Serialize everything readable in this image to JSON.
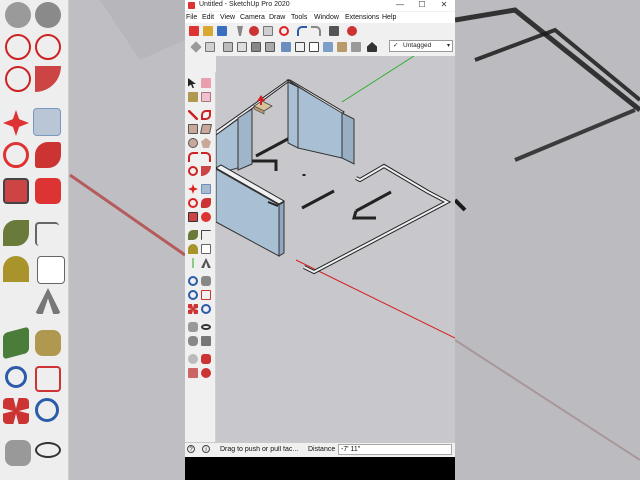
{
  "window": {
    "title": "Untitled - SketchUp Pro 2020",
    "minimize": "—",
    "maximize": "☐",
    "close": "✕"
  },
  "menu": [
    "File",
    "Edit",
    "View",
    "Camera",
    "Draw",
    "Tools",
    "Window",
    "Extensions",
    "Help"
  ],
  "tag_selector": {
    "check": "✓",
    "value": "Untagged",
    "arrow": "▾"
  },
  "status": {
    "message": "Drag to push or pull fac...",
    "distance_label": "Distance",
    "distance_value": "-7' 11\""
  },
  "colors": {
    "viewport_bg": "#c8c7cc",
    "wall_face": "#a9bfd3",
    "wall_top": "#eef0f2",
    "red_axis": "#d42020",
    "green_axis": "#2fae2f",
    "pushpull_arrow": "#d42020"
  },
  "icons": {
    "toolbar_row1": [
      "new-icon",
      "open-icon",
      "save-icon",
      "cut-icon",
      "copy-icon",
      "paste-icon",
      "erase-icon",
      "undo-icon",
      "redo-icon",
      "print-icon",
      "model-info-icon"
    ],
    "toolbar_row2": [
      "iso-view-icon",
      "top-view-icon",
      "front-view-icon",
      "right-view-icon",
      "back-view-icon",
      "left-view-icon",
      "xray-icon",
      "wireframe-icon",
      "hidden-line-icon",
      "shaded-icon",
      "textured-icon",
      "monochrome-icon",
      "warehouse-icon",
      "components-icon",
      "home-icon",
      "house-icon",
      "extension-icon"
    ]
  }
}
